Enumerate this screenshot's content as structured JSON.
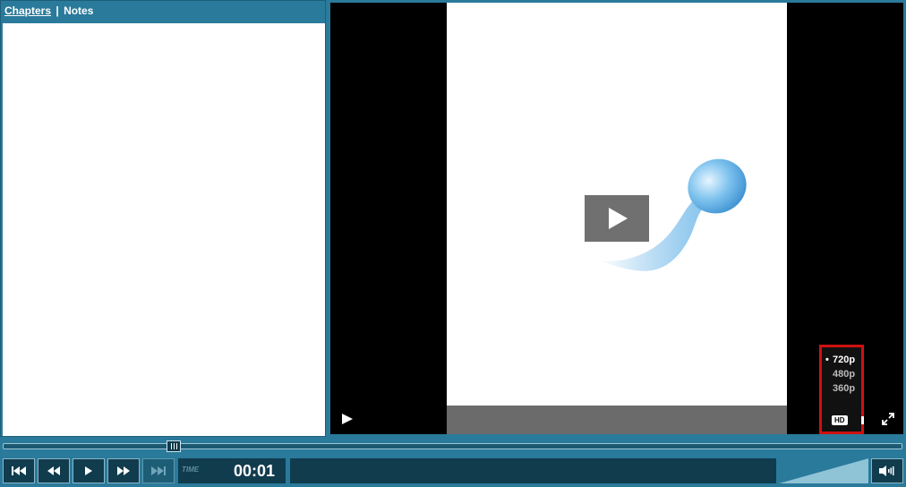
{
  "left_panel": {
    "tabs": [
      {
        "label": "Chapters",
        "active": true
      },
      {
        "label": "Notes",
        "active": false
      }
    ],
    "separator": "|"
  },
  "video": {
    "quality_options": [
      {
        "label": "720p",
        "selected": true
      },
      {
        "label": "480p",
        "selected": false
      },
      {
        "label": "360p",
        "selected": false
      }
    ],
    "hd_badge": "HD",
    "icons": [
      "big-play-icon",
      "play-icon",
      "fullscreen-icon"
    ]
  },
  "seek": {
    "progress_fraction": 0.19
  },
  "controls": {
    "buttons": [
      "skip-to-start-icon",
      "rewind-icon",
      "play-icon",
      "fast-forward-icon",
      "skip-to-end-icon"
    ],
    "time_label": "TIME",
    "time_value": "00:01",
    "volume_icon": "volume-icon"
  },
  "colors": {
    "chrome": "#2a7a9b",
    "dark": "#113c4e",
    "highlight_border": "#d01010"
  }
}
